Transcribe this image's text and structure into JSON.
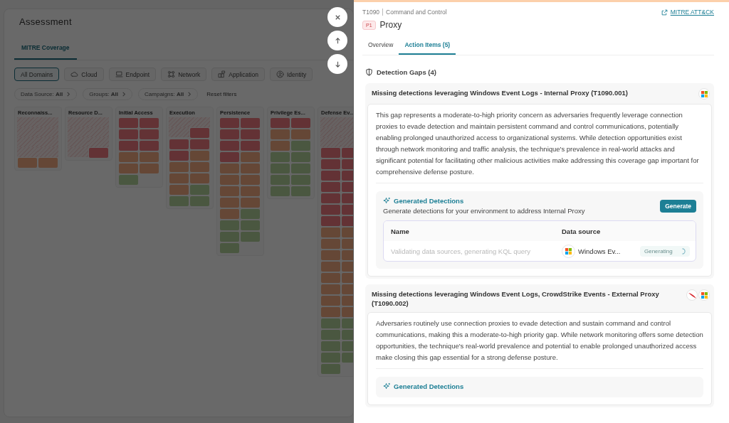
{
  "assessment": {
    "title": "Assessment",
    "tabs": [
      {
        "label": "MITRE Coverage",
        "selected": true
      }
    ],
    "domains": [
      {
        "label": "All Domains",
        "kind": "plain",
        "selected": true
      },
      {
        "label": "Cloud",
        "kind": "cloud",
        "selected": false
      },
      {
        "label": "Endpoint",
        "kind": "endpoint",
        "selected": false
      },
      {
        "label": "Network",
        "kind": "network",
        "selected": false
      },
      {
        "label": "Application",
        "kind": "application",
        "selected": false
      },
      {
        "label": "Identity",
        "kind": "identity",
        "selected": false
      }
    ],
    "filters": [
      "Data Source: **All**",
      "Groups: **All**",
      "Campaigns: **All**"
    ],
    "reset": "Reset filters",
    "tactics": [
      {
        "name": "Reconnaiss...",
        "cells": [
          {
            "kind": "gap"
          },
          {
            "kind": "gap"
          },
          {
            "kind": "gap"
          },
          {
            "kind": "gap"
          },
          {
            "kind": "gap"
          },
          {
            "kind": "gap"
          },
          {
            "kind": "gap"
          },
          {
            "kind": "gap"
          },
          {
            "kind": "medium"
          },
          {
            "kind": "medium"
          }
        ]
      },
      {
        "name": "Resource D...",
        "cells": [
          {
            "kind": "gap"
          },
          {
            "kind": "gap"
          },
          {
            "kind": "gap"
          },
          {
            "kind": "gap"
          },
          {
            "kind": "gap"
          },
          {
            "kind": "gap"
          },
          {
            "kind": "gap"
          },
          {
            "kind": "high"
          }
        ]
      },
      {
        "name": "Initial Access",
        "cells": [
          {
            "kind": "high"
          },
          {
            "kind": "high"
          },
          {
            "kind": "high"
          },
          {
            "kind": "high"
          },
          {
            "kind": "high"
          },
          {
            "kind": "high"
          },
          {
            "kind": "medium"
          },
          {
            "kind": "medium"
          },
          {
            "kind": "medium"
          },
          {
            "kind": "medium"
          },
          {
            "kind": "low"
          }
        ]
      },
      {
        "name": "Execution",
        "cells": [
          {
            "kind": "gap"
          },
          {
            "kind": "gap"
          },
          {
            "kind": "gap"
          },
          {
            "kind": "high"
          },
          {
            "kind": "high"
          },
          {
            "kind": "high"
          },
          {
            "kind": "high"
          },
          {
            "kind": "medium"
          },
          {
            "kind": "medium"
          },
          {
            "kind": "medium"
          },
          {
            "kind": "medium"
          },
          {
            "kind": "medium"
          },
          {
            "kind": "medium"
          },
          {
            "kind": "low"
          },
          {
            "kind": "low"
          },
          {
            "kind": "low"
          }
        ]
      },
      {
        "name": "Persistence",
        "cells": [
          {
            "kind": "high"
          },
          {
            "kind": "high"
          },
          {
            "kind": "high"
          },
          {
            "kind": "high"
          },
          {
            "kind": "high"
          },
          {
            "kind": "high"
          },
          {
            "kind": "high"
          },
          {
            "kind": "medium"
          },
          {
            "kind": "medium"
          },
          {
            "kind": "medium"
          },
          {
            "kind": "medium"
          },
          {
            "kind": "medium"
          },
          {
            "kind": "medium"
          },
          {
            "kind": "medium"
          },
          {
            "kind": "medium"
          },
          {
            "kind": "medium"
          },
          {
            "kind": "medium"
          },
          {
            "kind": "low"
          },
          {
            "kind": "low"
          },
          {
            "kind": "low"
          },
          {
            "kind": "low"
          },
          {
            "kind": "low"
          },
          {
            "kind": "low"
          }
        ]
      },
      {
        "name": "Privilege Es...",
        "cells": [
          {
            "kind": "high"
          },
          {
            "kind": "high"
          },
          {
            "kind": "medium"
          },
          {
            "kind": "medium"
          },
          {
            "kind": "medium"
          },
          {
            "kind": "low"
          },
          {
            "kind": "low"
          },
          {
            "kind": "low"
          },
          {
            "kind": "low"
          },
          {
            "kind": "low"
          },
          {
            "kind": "low"
          },
          {
            "kind": "low"
          },
          {
            "kind": "low"
          },
          {
            "kind": "low"
          }
        ]
      },
      {
        "name": "Defense Ev...",
        "cells": [
          {
            "kind": "gap"
          },
          {
            "kind": "gap"
          },
          {
            "kind": "gap"
          },
          {
            "kind": "gap"
          },
          {
            "kind": "gap"
          },
          {
            "kind": "gap"
          },
          {
            "kind": "high"
          },
          {
            "kind": "high"
          },
          {
            "kind": "high"
          },
          {
            "kind": "high"
          },
          {
            "kind": "high"
          },
          {
            "kind": "high"
          },
          {
            "kind": "high"
          },
          {
            "kind": "high"
          },
          {
            "kind": "high"
          },
          {
            "kind": "high"
          },
          {
            "kind": "high"
          },
          {
            "kind": "high"
          },
          {
            "kind": "high"
          },
          {
            "kind": "high"
          },
          {
            "kind": "medium"
          },
          {
            "kind": "medium"
          },
          {
            "kind": "medium"
          },
          {
            "kind": "medium"
          },
          {
            "kind": "medium"
          },
          {
            "kind": "medium"
          },
          {
            "kind": "medium"
          },
          {
            "kind": "medium"
          },
          {
            "kind": "medium"
          },
          {
            "kind": "medium"
          },
          {
            "kind": "medium"
          },
          {
            "kind": "medium"
          },
          {
            "kind": "medium"
          },
          {
            "kind": "medium"
          },
          {
            "kind": "medium"
          },
          {
            "kind": "medium"
          },
          {
            "kind": "low"
          },
          {
            "kind": "low"
          },
          {
            "kind": "low"
          },
          {
            "kind": "low"
          },
          {
            "kind": "low"
          },
          {
            "kind": "low"
          },
          {
            "kind": "low"
          },
          {
            "kind": "low"
          },
          {
            "kind": "low"
          }
        ]
      }
    ]
  },
  "detail": {
    "technique_id": "T1090",
    "tactic": "Command and Control",
    "link": "MITRE ATT&CK",
    "priority": "P1",
    "name": "Proxy",
    "tabs": [
      {
        "label": "Overview",
        "selected": false
      },
      {
        "label": "Action Items (5)",
        "selected": true
      }
    ],
    "section": "Detection Gaps (4)",
    "gaps": [
      {
        "title": "Missing detections leveraging Windows Event Logs - Internal Proxy (T1090.001)",
        "sources": [
          {
            "kind": "windows"
          }
        ],
        "description": "This gap represents a moderate-to-high priority concern as adversaries frequently leverage connection proxies to evade detection and maintain persistent command and control communications, potentially enabling prolonged unauthorized access to organizational systems. While detection opportunities exist through network monitoring and traffic analysis, the technique's prevalence in real-world attacks and significant potential for facilitating other malicious activities make addressing this coverage gap important for comprehensive defense posture.",
        "generated": {
          "title": "Generated Detections",
          "subtitle": "Generate detections for your environment to address Internal Proxy",
          "button": "Generate",
          "columns": [
            "Name",
            "Data source"
          ],
          "rows": [
            {
              "name": "Validating data sources, generating KQL query",
              "source_icon": {
                "kind": "windows"
              },
              "source": "Windows Ev...",
              "status": "Generating"
            }
          ]
        }
      },
      {
        "title": "Missing detections leveraging Windows Event Logs, CrowdStrike Events - External Proxy (T1090.002)",
        "sources": [
          {
            "kind": "swoosh"
          },
          {
            "kind": "windows"
          }
        ],
        "description": "Adversaries routinely use connection proxies to evade detection and sustain command and control communications, making this a moderate-to-high priority gap. While network monitoring offers some detection opportunities, the technique's real-world prevalence and potential to enable prolonged unauthorized access make closing this gap essential for a strong defense posture.",
        "generated": {
          "title": "Generated Detections"
        }
      }
    ]
  },
  "nav_buttons": [
    {
      "kind": "close"
    },
    {
      "kind": "up"
    },
    {
      "kind": "down"
    }
  ]
}
